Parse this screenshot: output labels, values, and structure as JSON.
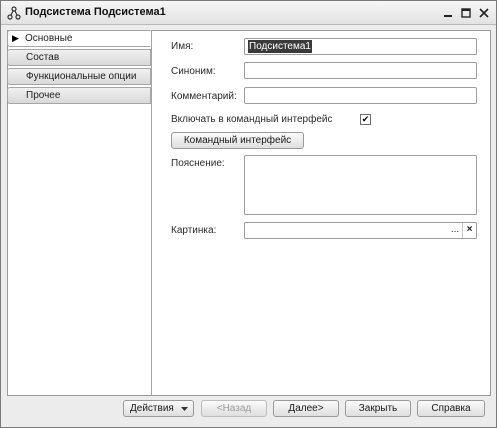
{
  "window": {
    "title": "Подсистема Подсистема1"
  },
  "tabs": [
    {
      "label": "Основные",
      "active": true
    },
    {
      "label": "Состав",
      "active": false
    },
    {
      "label": "Функциональные опции",
      "active": false
    },
    {
      "label": "Прочее",
      "active": false
    }
  ],
  "form": {
    "name_label": "Имя:",
    "name_value": "Подсистема1",
    "synonym_label": "Синоним:",
    "synonym_value": "",
    "comment_label": "Комментарий:",
    "comment_value": "",
    "include_label": "Включать в командный интерфейс",
    "include_checked": true,
    "command_interface_button": "Командный интерфейс",
    "explanation_label": "Пояснение:",
    "explanation_value": "",
    "picture_label": "Картинка:",
    "picture_value": "",
    "picture_select": "...",
    "picture_clear": "×"
  },
  "footer": {
    "actions": "Действия",
    "back": "<Назад",
    "next": "Далее>",
    "close": "Закрыть",
    "help": "Справка"
  },
  "colors": {
    "selection": "#3a3a3a",
    "window_bg": "#ececec"
  }
}
